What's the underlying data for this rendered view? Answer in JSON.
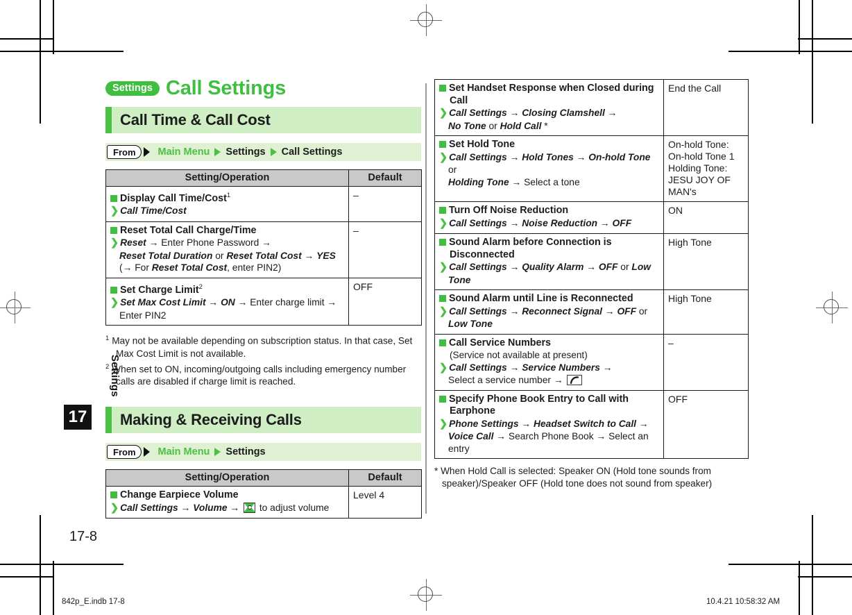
{
  "document": {
    "chapter_badge": "Settings",
    "chapter_title": "Call Settings",
    "side_tab_label": "Settings",
    "side_tab_number": "17",
    "page_number": "17-8",
    "footer_left": "842p_E.indb   17-8",
    "footer_right": "10.4.21   10:58:32 AM",
    "accent_green": "#3fbf3f",
    "band_green": "#cfeec3",
    "header_gray": "#c9c9c9"
  },
  "left_column": {
    "section_1": {
      "title": "Call Time & Call Cost",
      "from_label": "From",
      "breadcrumb": [
        "Main Menu",
        "Settings",
        "Call Settings"
      ],
      "table": {
        "headers": [
          "Setting/Operation",
          "Default"
        ],
        "rows": [
          {
            "title": "Display Call Time/Cost",
            "title_sup": "1",
            "steps": [
              {
                "parts": [
                  {
                    "t": "Call Time/Cost",
                    "s": "bi"
                  }
                ]
              }
            ],
            "default": "–"
          },
          {
            "title": "Reset Total Call Charge/Time",
            "title_sup": "",
            "steps": [
              {
                "parts": [
                  {
                    "t": "Reset",
                    "s": "bi"
                  },
                  {
                    "t": " → ",
                    "s": "ar"
                  },
                  {
                    "t": "Enter Phone Password",
                    "s": "n"
                  },
                  {
                    "t": " →",
                    "s": "ar"
                  }
                ]
              },
              {
                "parts": [
                  {
                    "t": "Reset Total Duration",
                    "s": "bi"
                  },
                  {
                    "t": " or ",
                    "s": "n"
                  },
                  {
                    "t": "Reset Total Cost",
                    "s": "bi"
                  },
                  {
                    "t": " → ",
                    "s": "ar"
                  },
                  {
                    "t": "YES",
                    "s": "bi"
                  }
                ],
                "cont": true
              },
              {
                "parts": [
                  {
                    "t": "(→ For ",
                    "s": "n"
                  },
                  {
                    "t": "Reset Total Cost",
                    "s": "bi"
                  },
                  {
                    "t": ", enter PIN2)",
                    "s": "n"
                  }
                ],
                "cont": true
              }
            ],
            "default": "–"
          },
          {
            "title": "Set Charge Limit",
            "title_sup": "2",
            "steps": [
              {
                "parts": [
                  {
                    "t": "Set Max Cost Limit",
                    "s": "bi"
                  },
                  {
                    "t": " → ",
                    "s": "ar"
                  },
                  {
                    "t": "ON",
                    "s": "bi"
                  },
                  {
                    "t": " → ",
                    "s": "ar"
                  },
                  {
                    "t": "Enter charge limit",
                    "s": "n"
                  },
                  {
                    "t": " →",
                    "s": "ar"
                  }
                ]
              },
              {
                "parts": [
                  {
                    "t": "Enter PIN2",
                    "s": "n"
                  }
                ],
                "cont": true
              }
            ],
            "default": "OFF"
          }
        ]
      },
      "footnotes": [
        {
          "marker": "1",
          "parts": [
            {
              "t": "May not be available depending on subscription status. In that case, Set Max Cost Limit is not available.",
              "s": "n"
            }
          ]
        },
        {
          "marker": "2",
          "parts": [
            {
              "t": "When set to ",
              "s": "n"
            },
            {
              "t": "ON",
              "s": "bi"
            },
            {
              "t": ", incoming/outgoing calls including emergency number calls are disabled if charge limit is reached.",
              "s": "n"
            }
          ]
        }
      ]
    },
    "section_2": {
      "title": "Making & Receiving Calls",
      "from_label": "From",
      "breadcrumb": [
        "Main Menu",
        "Settings"
      ],
      "table": {
        "headers": [
          "Setting/Operation",
          "Default"
        ],
        "rows": [
          {
            "title": "Change Earpiece Volume",
            "title_sup": "",
            "steps": [
              {
                "parts": [
                  {
                    "t": "Call Settings",
                    "s": "bi"
                  },
                  {
                    "t": " → ",
                    "s": "ar"
                  },
                  {
                    "t": "Volume",
                    "s": "bi"
                  },
                  {
                    "t": " → ",
                    "s": "ar"
                  },
                  {
                    "t": "",
                    "s": "icon-nav"
                  },
                  {
                    "t": " to adjust volume",
                    "s": "n"
                  }
                ]
              }
            ],
            "default": "Level 4"
          }
        ]
      }
    }
  },
  "right_column": {
    "table": {
      "rows": [
        {
          "title": "Set Handset Response when Closed during Call",
          "title_sup": "",
          "steps": [
            {
              "parts": [
                {
                  "t": "Call Settings",
                  "s": "bi"
                },
                {
                  "t": " → ",
                  "s": "ar"
                },
                {
                  "t": "Closing Clamshell",
                  "s": "bi"
                },
                {
                  "t": " →",
                  "s": "ar"
                }
              ]
            },
            {
              "parts": [
                {
                  "t": "No Tone",
                  "s": "bi"
                },
                {
                  "t": " or ",
                  "s": "n"
                },
                {
                  "t": "Hold Call",
                  "s": "bi"
                },
                {
                  "t": " *",
                  "s": "n"
                }
              ],
              "cont": true
            }
          ],
          "default": "End the Call"
        },
        {
          "title": "Set Hold Tone",
          "title_sup": "",
          "steps": [
            {
              "parts": [
                {
                  "t": "Call Settings",
                  "s": "bi"
                },
                {
                  "t": " → ",
                  "s": "ar"
                },
                {
                  "t": "Hold Tones",
                  "s": "bi"
                },
                {
                  "t": " → ",
                  "s": "ar"
                },
                {
                  "t": "On-hold Tone",
                  "s": "bi"
                },
                {
                  "t": " or",
                  "s": "n"
                }
              ]
            },
            {
              "parts": [
                {
                  "t": "Holding Tone",
                  "s": "bi"
                },
                {
                  "t": " → ",
                  "s": "ar"
                },
                {
                  "t": "Select a tone",
                  "s": "n"
                }
              ],
              "cont": true
            }
          ],
          "default": "On-hold Tone:\nOn-hold Tone 1\nHolding Tone:\nJESU JOY OF\nMAN's"
        },
        {
          "title": "Turn Off Noise Reduction",
          "title_sup": "",
          "steps": [
            {
              "parts": [
                {
                  "t": "Call Settings",
                  "s": "bi"
                },
                {
                  "t": " → ",
                  "s": "ar"
                },
                {
                  "t": "Noise Reduction",
                  "s": "bi"
                },
                {
                  "t": " → ",
                  "s": "ar"
                },
                {
                  "t": "OFF",
                  "s": "bi"
                }
              ]
            }
          ],
          "default": "ON"
        },
        {
          "title": "Sound Alarm before Connection is",
          "title_line2": "Disconnected",
          "title_sup": "",
          "steps": [
            {
              "parts": [
                {
                  "t": "Call Settings",
                  "s": "bi"
                },
                {
                  "t": " → ",
                  "s": "ar"
                },
                {
                  "t": "Quality Alarm",
                  "s": "bi"
                },
                {
                  "t": " → ",
                  "s": "ar"
                },
                {
                  "t": "OFF",
                  "s": "bi"
                },
                {
                  "t": " or ",
                  "s": "n"
                },
                {
                  "t": "Low Tone",
                  "s": "bi"
                }
              ]
            }
          ],
          "default": "High Tone"
        },
        {
          "title": "Sound Alarm until Line is Reconnected",
          "title_sup": "",
          "steps": [
            {
              "parts": [
                {
                  "t": "Call Settings",
                  "s": "bi"
                },
                {
                  "t": " → ",
                  "s": "ar"
                },
                {
                  "t": "Reconnect Signal",
                  "s": "bi"
                },
                {
                  "t": " → ",
                  "s": "ar"
                },
                {
                  "t": "OFF",
                  "s": "bi"
                },
                {
                  "t": " or",
                  "s": "n"
                }
              ]
            },
            {
              "parts": [
                {
                  "t": "Low Tone",
                  "s": "bi"
                }
              ],
              "cont": true
            }
          ],
          "default": "High Tone"
        },
        {
          "title": "Call Service Numbers",
          "title_sup": "",
          "note": "(Service not available at present)",
          "steps": [
            {
              "parts": [
                {
                  "t": "Call Settings",
                  "s": "bi"
                },
                {
                  "t": " → ",
                  "s": "ar"
                },
                {
                  "t": "Service Numbers",
                  "s": "bi"
                },
                {
                  "t": " →",
                  "s": "ar"
                }
              ]
            },
            {
              "parts": [
                {
                  "t": "Select a service number",
                  "s": "n"
                },
                {
                  "t": " → ",
                  "s": "ar"
                },
                {
                  "t": "",
                  "s": "icon-call"
                }
              ],
              "cont": true
            }
          ],
          "default": "–"
        },
        {
          "title": "Specify Phone Book Entry to Call with Earphone",
          "title_sup": "",
          "steps": [
            {
              "parts": [
                {
                  "t": "Phone Settings",
                  "s": "bi"
                },
                {
                  "t": " → ",
                  "s": "ar"
                },
                {
                  "t": "Headset Switch to Call",
                  "s": "bi"
                },
                {
                  "t": " →",
                  "s": "ar"
                }
              ]
            },
            {
              "parts": [
                {
                  "t": "Voice Call",
                  "s": "bi"
                },
                {
                  "t": " → ",
                  "s": "ar"
                },
                {
                  "t": "Search Phone Book",
                  "s": "n"
                },
                {
                  "t": " → ",
                  "s": "ar"
                },
                {
                  "t": "Select an entry",
                  "s": "n"
                }
              ],
              "cont": true
            }
          ],
          "default": "OFF"
        }
      ]
    },
    "footnote_star": {
      "marker": "*",
      "parts": [
        {
          "t": "When Hold Call is selected: ",
          "s": "n"
        },
        {
          "t": "Speaker ON",
          "s": "bi"
        },
        {
          "t": " (Hold tone sounds from speaker)/",
          "s": "n"
        },
        {
          "t": "Speaker OFF",
          "s": "bi"
        },
        {
          "t": " (Hold tone does not sound from speaker)",
          "s": "n"
        }
      ]
    }
  }
}
